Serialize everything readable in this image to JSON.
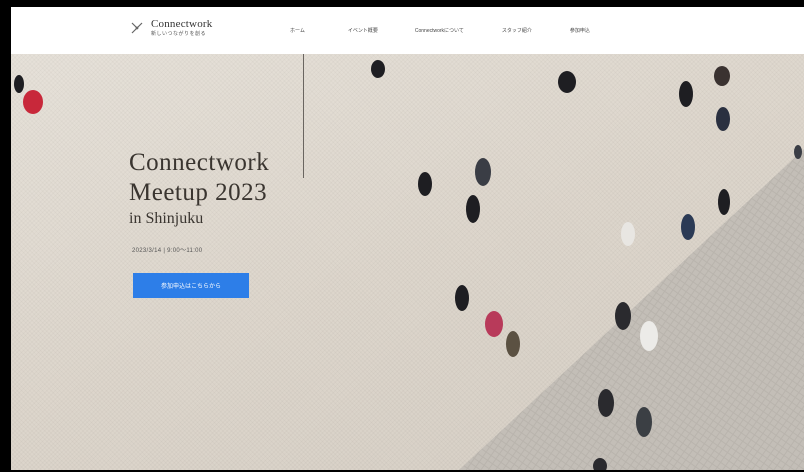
{
  "header": {
    "logo_name": "Connectwork",
    "logo_sub": "新しいつながりを創る",
    "nav": [
      "ホーム",
      "イベント概要",
      "Connectworkについて",
      "スタッフ紹介",
      "参加申込"
    ]
  },
  "hero": {
    "title_line1": "Connectwork",
    "title_line2": "Meetup 2023",
    "subtitle": "in Shinjuku",
    "date": "2023/3/14 | 9:00〜11:00",
    "cta_label": "参加申込はこちらから"
  },
  "colors": {
    "accent": "#2d7ee8",
    "header_bg": "#ffffff",
    "hero_bg": "#ddd6cc",
    "title_text": "#3a3530"
  },
  "icons": [
    "logo-mark-icon"
  ]
}
